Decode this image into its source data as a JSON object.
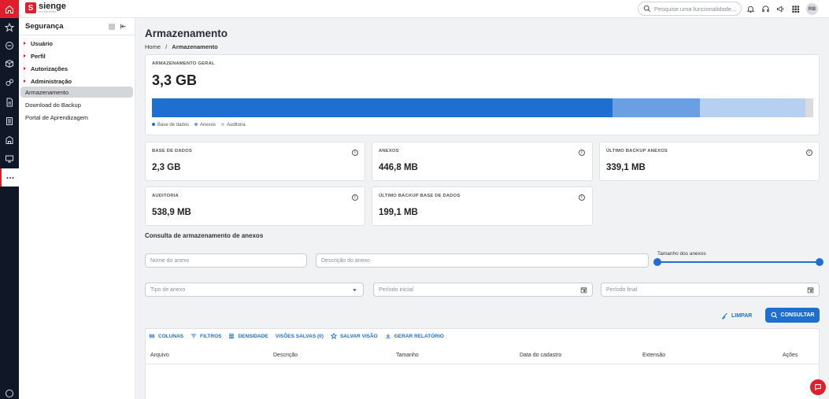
{
  "app": {
    "logo_text": "sienge",
    "logo_sub": "PLATAFORMA"
  },
  "header": {
    "search_placeholder": "Pesquise uma funcionalidade...",
    "avatar_initials": "RB"
  },
  "rail": {
    "icons": [
      "home-icon",
      "star-icon",
      "minus-circle-icon",
      "box-icon",
      "settings-icon",
      "document-icon",
      "list-icon",
      "building-icon",
      "monitor-icon",
      "more-icon"
    ]
  },
  "sidebar": {
    "title": "Segurança",
    "groups": [
      {
        "label": "Usuário"
      },
      {
        "label": "Perfil"
      },
      {
        "label": "Autorizações"
      },
      {
        "label": "Administração"
      }
    ],
    "links": [
      {
        "label": "Armazenamento"
      },
      {
        "label": "Download do Backup"
      },
      {
        "label": "Portal de Aprendizagem"
      }
    ]
  },
  "page": {
    "title": "Armazenamento",
    "breadcrumb": {
      "home": "Home",
      "separator": "/",
      "current": "Armazenamento"
    }
  },
  "overview": {
    "label": "ARMAZENAMENTO GERAL",
    "total": "3,3 GB",
    "segments": [
      {
        "name": "Base de dados",
        "fraction": 0.697,
        "color": "#1f6fd1"
      },
      {
        "name": "Anexos",
        "fraction": 0.131,
        "color": "#6a9fe3"
      },
      {
        "name": "Auditoria",
        "fraction": 0.16,
        "color": "#b6d0f2"
      }
    ],
    "remainder_color": "#d9dbde"
  },
  "stats": [
    {
      "label": "BASE DE DADOS",
      "value": "2,3 GB"
    },
    {
      "label": "ANEXOS",
      "value": "446,8 MB"
    },
    {
      "label": "ÚLTIMO BACKUP ANEXOS",
      "value": "339,1 MB"
    },
    {
      "label": "AUDITORIA",
      "value": "538,9 MB"
    },
    {
      "label": "ÚLTIMO BACKUP BASE DE DADOS",
      "value": "199,1 MB"
    }
  ],
  "query": {
    "title": "Consulta de armazenamento de anexos",
    "name_placeholder": "Nome do anexo",
    "description_placeholder": "Descrição do anexo",
    "size_label": "Tamanho dos anexos",
    "type_placeholder": "Tipo de anexo",
    "start_placeholder": "Período inicial",
    "end_placeholder": "Período final",
    "clear_label": "LIMPAR",
    "search_label": "CONSULTAR"
  },
  "grid": {
    "toolbar": [
      "COLUNAS",
      "FILTROS",
      "DENSIDADE",
      "VISÕES SALVAS (0)",
      "SALVAR VISÃO",
      "GERAR RELATÓRIO"
    ],
    "columns": [
      "Arquivo",
      "Descrição",
      "Tamanho",
      "Data do cadastro",
      "Extensão",
      "Ações"
    ]
  }
}
